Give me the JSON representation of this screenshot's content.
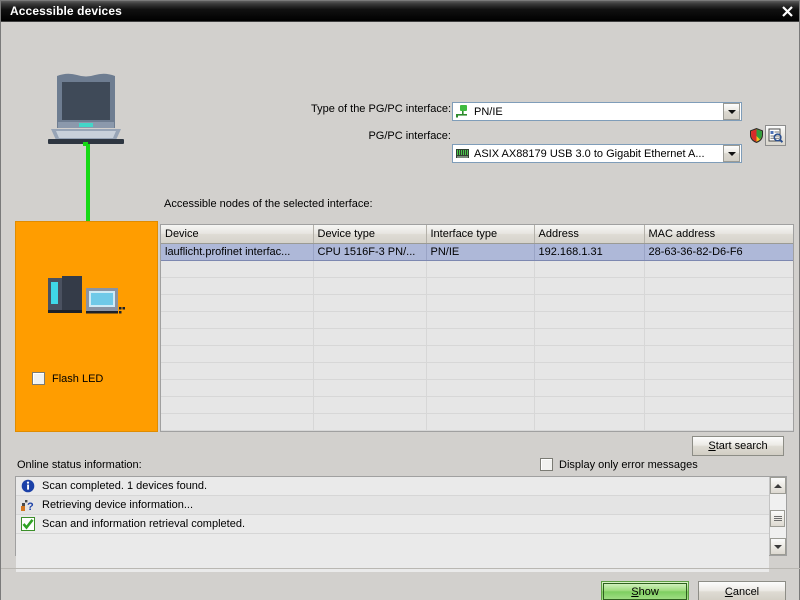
{
  "window": {
    "title": "Accessible devices",
    "close_icon": "close-icon"
  },
  "graphics": {
    "laptop_icon": "laptop-icon",
    "cable_color": "#16d916",
    "panel_color": "#ff9d00",
    "plc_icon": "plc-device-icon"
  },
  "interface_form": {
    "type_label": "Type of the PG/PC interface:",
    "type_value": "PN/IE",
    "type_icon": "network-node-icon",
    "pgpc_label": "PG/PC interface:",
    "pgpc_value": "ASIX AX88179 USB 3.0 to Gigabit Ethernet A...",
    "pgpc_icon": "network-card-icon",
    "shield_icon": "shield-icon",
    "properties_icon": "properties-search-icon",
    "dropdown_icon": "chevron-down-icon"
  },
  "flash_led": {
    "label": "Flash LED",
    "checked": false
  },
  "nodes": {
    "label": "Accessible nodes of the selected interface:",
    "columns": [
      "Device",
      "Device type",
      "Interface type",
      "Address",
      "MAC address"
    ],
    "rows": [
      {
        "device": "lauflicht.profinet interfac...",
        "device_type": "CPU 1516F-3 PN/...",
        "interface_type": "PN/IE",
        "address": "192.168.1.31",
        "mac_address": "28-63-36-82-D6-F6",
        "selected": true
      }
    ],
    "empty_row_count": 10,
    "selected_row_color": "#aeb8d8"
  },
  "actions": {
    "start_search": "Start search",
    "start_search_accel": "S"
  },
  "status": {
    "label": "Online status information:",
    "error_filter_label": "Display only error messages",
    "error_filter_checked": false,
    "messages": [
      {
        "icon": "info-icon",
        "text": "Scan completed. 1 devices found."
      },
      {
        "icon": "question-icon",
        "text": "Retrieving device information..."
      },
      {
        "icon": "success-icon",
        "text": "Scan and information retrieval completed."
      }
    ],
    "scrollbar": {
      "up_icon": "scroll-up-icon",
      "down_icon": "scroll-down-icon",
      "thumb_icon": "scrollbar-thumb"
    }
  },
  "footer": {
    "show_label": "Show",
    "show_accel": "S",
    "cancel_label": "Cancel",
    "cancel_accel": "C"
  }
}
